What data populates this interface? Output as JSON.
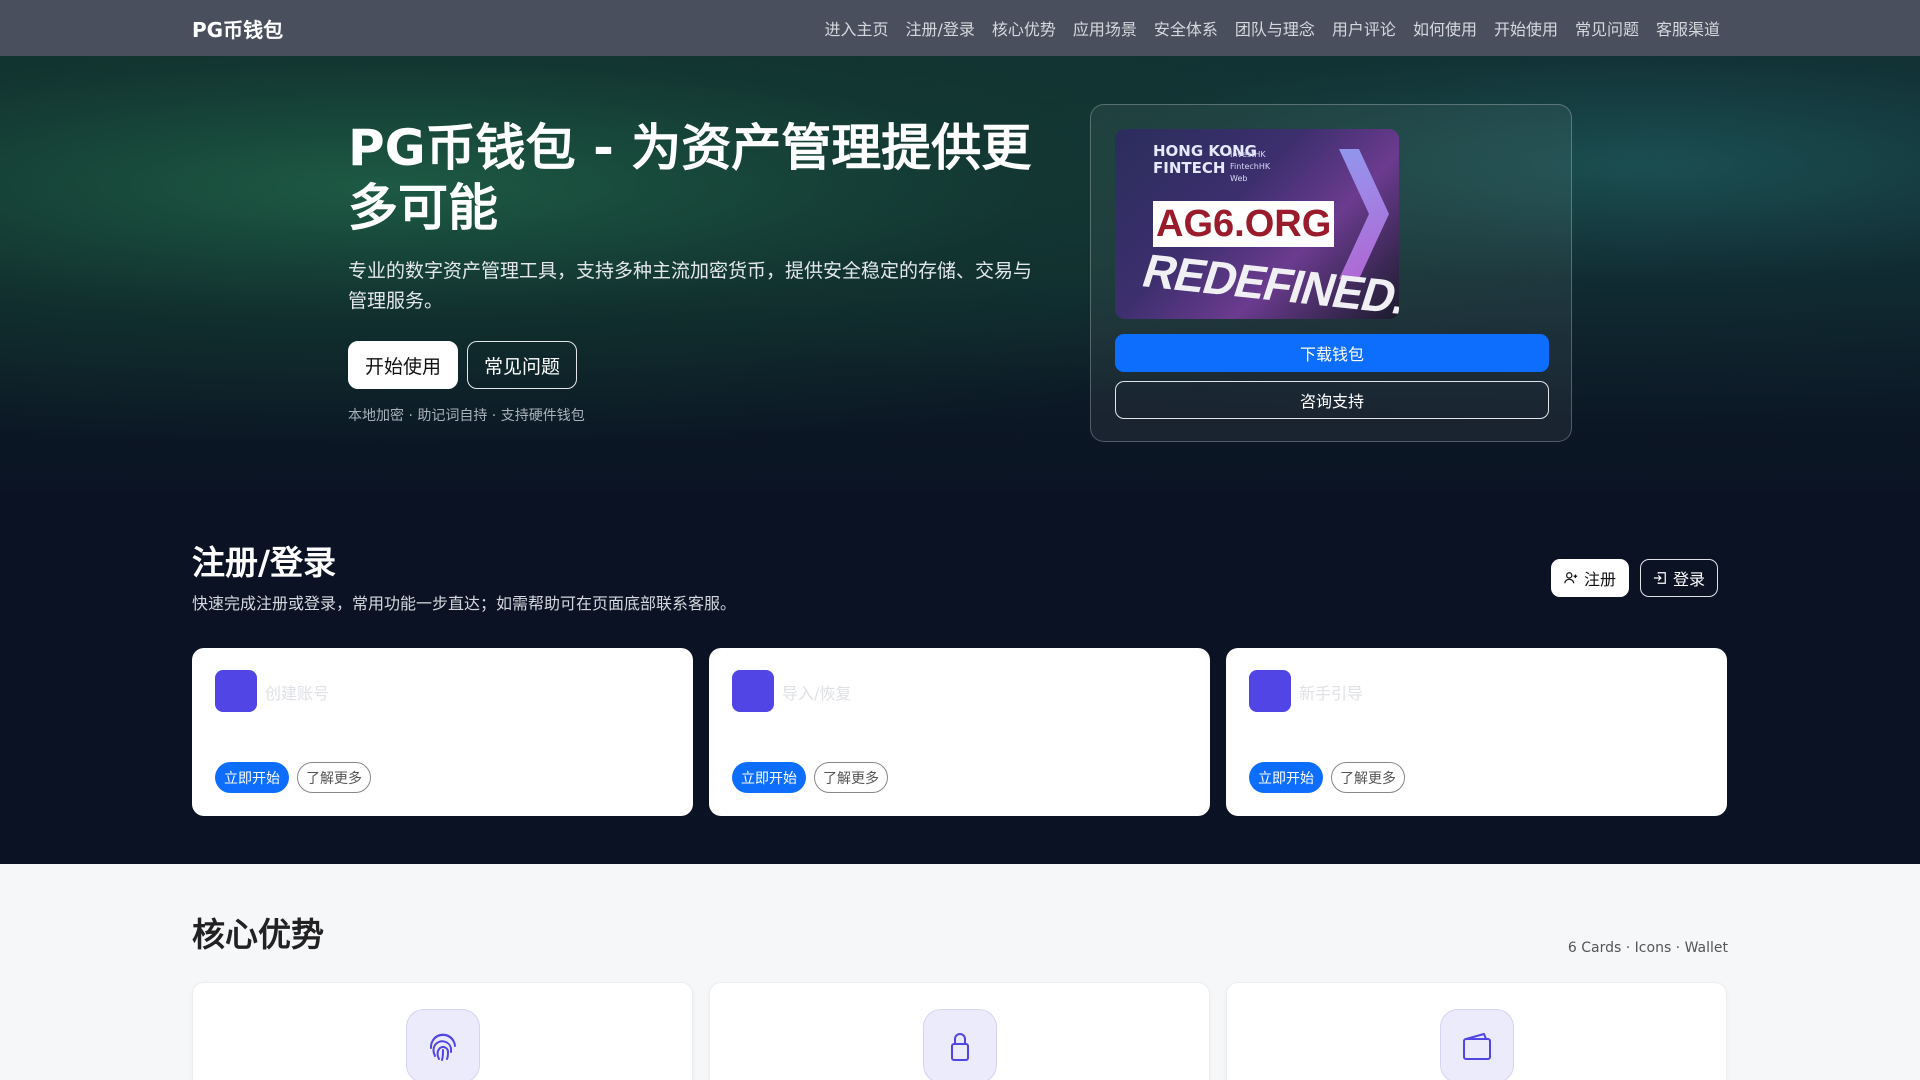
{
  "navbar": {
    "brand": "PG币钱包",
    "links": [
      "进入主页",
      "注册/登录",
      "核心优势",
      "应用场景",
      "安全体系",
      "团队与理念",
      "用户评论",
      "如何使用",
      "开始使用",
      "常见问题",
      "客服渠道"
    ]
  },
  "hero": {
    "title": "PG币钱包 - 为资产管理提供更多可能",
    "subtitle": "专业的数字资产管理工具，支持多种主流加密货币，提供安全稳定的存储、交易与管理服务。",
    "primary_button": "开始使用",
    "secondary_button": "常见问题",
    "note": "本地加密 · 助记词自持 · 支持硬件钱包",
    "card": {
      "image_text": {
        "hong_kong": "HONG KONG",
        "fintech": "FINTECH",
        "small_lines": [
          "InvestHK",
          "FintechHK",
          "Web"
        ],
        "watermark": "AG6.ORG",
        "banner": "REDEFINED."
      },
      "download_button": "下载钱包",
      "consult_button": "咨询支持"
    }
  },
  "register": {
    "title": "注册/登录",
    "description": "快速完成注册或登录，常用功能一步直达；如需帮助可在页面底部联系客服。",
    "signup_button": "注册",
    "login_button": "登录",
    "cards": [
      {
        "label": "创建账号",
        "primary": "立即开始",
        "secondary": "了解更多"
      },
      {
        "label": "导入/恢复",
        "primary": "立即开始",
        "secondary": "了解更多"
      },
      {
        "label": "新手引导",
        "primary": "立即开始",
        "secondary": "了解更多"
      }
    ],
    "icons": {
      "signup": "user-plus-icon",
      "login": "login-icon"
    }
  },
  "core": {
    "title": "核心优势",
    "meta": "6 Cards · Icons · Wallet",
    "cards": [
      {
        "icon": "fingerprint-icon"
      },
      {
        "icon": "lock-icon"
      },
      {
        "icon": "wallet-icon"
      }
    ]
  },
  "colors": {
    "accent_blue": "#0d6efd",
    "accent_purple": "#5145e5",
    "navbar_bg": "#4a4f5e",
    "section_dark": "#0b1223"
  }
}
